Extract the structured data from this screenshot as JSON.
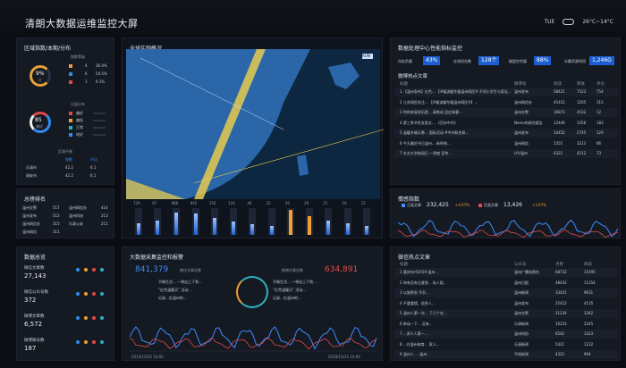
{
  "header": {
    "title": "清朗大数据运维监控大屏",
    "day": "TUE",
    "weather": "26°C~14°C"
  },
  "panels": {
    "region": {
      "title": "区域指数/本期/分布",
      "ring1": {
        "value": "9%",
        "sub": "红"
      },
      "legend1_title": "指数等级",
      "legend1": [
        {
          "value": "4",
          "pct": "36.4%"
        },
        {
          "value": "6",
          "pct": "54.5%"
        },
        {
          "value": "1",
          "pct": "9.1%"
        }
      ],
      "ring2": {
        "value": "85",
        "sub": "偏好"
      },
      "legend2_title": "分值分布",
      "legend2": [
        "偏好",
        "偏低",
        "正常",
        "较好"
      ],
      "tbl_title": "区域平衡",
      "tbl_headers": [
        "",
        "指数",
        "环比"
      ],
      "tbl_rows": [
        [
          "乐清市",
          "42.2",
          "6.1"
        ],
        [
          "瑞安市",
          "42.2",
          "6.1"
        ]
      ]
    },
    "rank": {
      "title": "总榜排名",
      "rows": [
        [
          "温州交警",
          "517",
          "温州网信办",
          "414"
        ],
        [
          "温州发布",
          "512",
          "温州科协",
          "213"
        ],
        [
          "温州网信办",
          "315",
          "乐清公安",
          "211"
        ],
        [
          "温州网信",
          "311",
          "",
          ""
        ]
      ]
    },
    "global": {
      "title": "全球实例概况",
      "chip": "RUN",
      "bar_tops": [
        "729",
        "87",
        "988",
        "945",
        "350",
        "124",
        "46",
        "22",
        "26",
        "29",
        "25",
        "18",
        "12"
      ],
      "bar_fills": [
        0.45,
        0.55,
        0.85,
        0.8,
        0.65,
        0.5,
        0.4,
        0.35,
        0.95,
        0.7,
        0.55,
        0.45,
        0.35
      ],
      "bar_labels": [
        "",
        "",
        "",
        "",
        "",
        "",
        "",
        "",
        "",
        "",
        "",
        "",
        ""
      ]
    },
    "throughput": {
      "title": "数据处理中心性能指标监控",
      "tags": [
        [
          "内存负载",
          "43%"
        ],
        [
          "在线机台数",
          "128个"
        ],
        [
          "磁盘空余量",
          "88%"
        ],
        [
          "计算资源利用",
          "1,246G"
        ]
      ],
      "table_title": "微博热点文章",
      "headers": [
        "标题",
        "微博号",
        "阅读",
        "转发",
        "评论"
      ],
      "rows": [
        [
          "1 【温州发布】红色... 【#暖流暖冬暖温州网民#  不同小学生与家长...",
          "温州发布",
          "58421",
          "7523",
          "754"
        ],
        [
          "2 江苏网民关注...  【#暖流暖冬暖温州网民#】...",
          "温州网信办",
          "45412",
          "1265",
          "315"
        ],
        [
          "3 你的亲身经历是... 高铁站 回应乘客...",
          "温州交警",
          "16873",
          "4532",
          "12"
        ],
        [
          "4 第三季节性发表文...  《百年中华》",
          "Nemo的研究报告",
          "12449",
          "3356",
          "183"
        ],
        [
          "5 温暖冬晴天寒...  国际活动 #中外联合体...",
          "温州发布",
          "10452",
          "2745",
          "129"
        ],
        [
          "6 今天美好节日温州...  新举措...",
          "温州网信",
          "1355",
          "3213",
          "86"
        ],
        [
          "7 东方大学校园日 一季度 宣传...",
          "LYV温州",
          "6322",
          "4212",
          "73"
        ]
      ]
    },
    "sentiment": {
      "title": "情感指数",
      "legend": [
        [
          "正面文章",
          "232,425",
          "+4.67%"
        ],
        [
          "负面文章",
          "13,426",
          "+3.67%"
        ]
      ],
      "ylabels": [
        "300",
        "200",
        "100",
        "0"
      ],
      "xlabels": [
        "",
        "",
        "",
        "",
        "",
        "",
        "",
        "",
        "",
        "",
        "",
        "",
        ""
      ]
    },
    "datasrc": {
      "title": "数据总览",
      "items": [
        [
          "微信文章数",
          "27,143"
        ],
        [
          "微信公众号数",
          "372"
        ],
        [
          "微博文章数",
          "6,572"
        ],
        [
          "微博账号数",
          "187"
        ]
      ]
    },
    "collect": {
      "title": "大数据采集监控和报警",
      "num1": "841,379",
      "label1": "微信文章总数",
      "num2": "634,891",
      "label2": "微博文章总数",
      "left_items": [
        "不做生活... 一带自上下到...",
        "“红色温暖天” 活动...",
        "记录...在温州的..."
      ],
      "right_items": [
        "不做生活... 一带自上下到...",
        "“红色温暖天” 活动...",
        "记录...在温州的..."
      ],
      "times": [
        "2019/10/25 10:00",
        "2019/10/25 10:00"
      ],
      "xlabels": [
        "",
        "",
        "",
        ""
      ]
    },
    "wechat": {
      "title": "微信热点文章",
      "headers": [
        "标题",
        "公众号",
        "点赞",
        "阅读"
      ],
      "rows": [
        [
          "1 喜庆年代2019 温州... ",
          "温州广播电视台",
          "68732",
          "15495"
        ],
        [
          "2 你有没有注意到... 私人租...",
          "温州日报",
          "48432",
          "11354"
        ],
        [
          "3 以旅养农 不负...",
          "温州新闻",
          "33421",
          "9631"
        ],
        [
          "4 不要看错，很多人...",
          "温州发布",
          "25412",
          "4135"
        ],
        [
          "5 温州人第一次... 了几个名...",
          "温州交警",
          "21234",
          "3342"
        ],
        [
          "6 带动一下... 没有...",
          "乐清新闻",
          "10233",
          "2245"
        ],
        [
          "7 ...多少人第一...",
          "温州科协",
          "6542",
          "1323"
        ],
        [
          "8 ...在温州体育... 家人...",
          "乐清新闻",
          "5421",
          "1122"
        ],
        [
          "9 温州人 ... 温州... ",
          "平阳新闻",
          "4321",
          "994"
        ]
      ]
    }
  },
  "colors": {
    "accent": "#1e90ff",
    "orange": "#f0a030",
    "red": "#e14a4a",
    "teal": "#2bb3c0"
  }
}
